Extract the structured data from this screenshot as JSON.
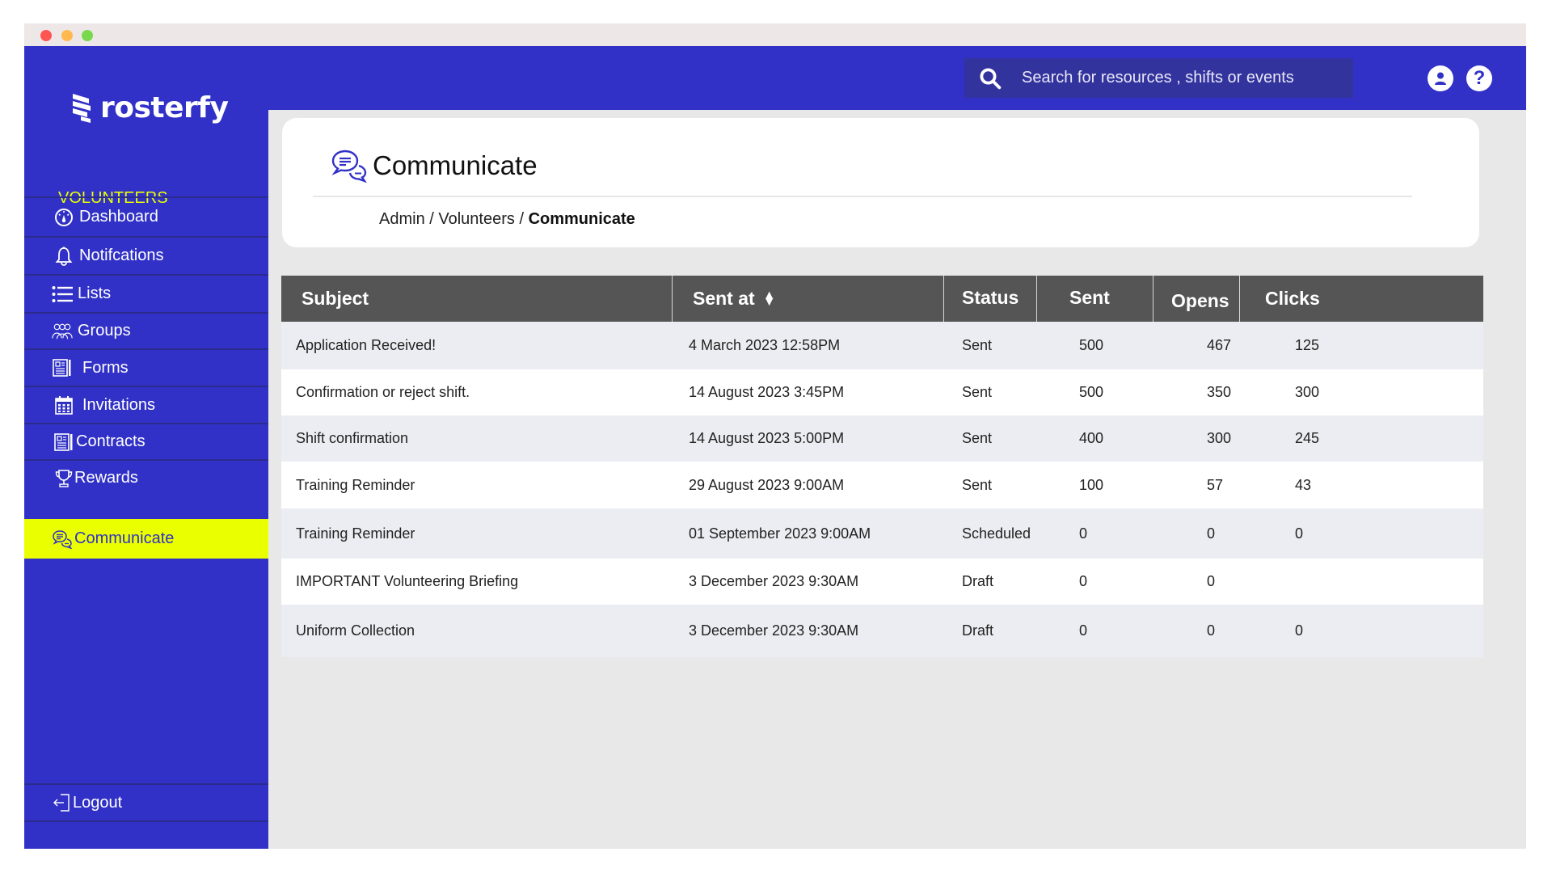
{
  "window": {
    "controls": [
      "close",
      "minimize",
      "maximize"
    ]
  },
  "brand": {
    "name": "rosterfy",
    "primary_color": "#3131c7",
    "accent_color": "#eaff00"
  },
  "topbar": {
    "search_placeholder": "Search for resources , shifts or events",
    "search_icon": "search-icon",
    "user_icon": "user-icon",
    "help_icon": "help-icon",
    "help_glyph": "?"
  },
  "sidebar": {
    "section_label": "VOLUNTEERS",
    "items": [
      {
        "label": "Dashboard",
        "icon": "dashboard-icon",
        "active": false
      },
      {
        "label": "Notifcations",
        "icon": "bell-icon",
        "active": false
      },
      {
        "label": "Lists",
        "icon": "list-icon",
        "active": false
      },
      {
        "label": "Groups",
        "icon": "groups-icon",
        "active": false
      },
      {
        "label": "Forms",
        "icon": "forms-icon",
        "active": false
      },
      {
        "label": "Invitations",
        "icon": "calendar-icon",
        "active": false
      },
      {
        "label": "Contracts",
        "icon": "contracts-icon",
        "active": false
      },
      {
        "label": "Rewards",
        "icon": "trophy-icon",
        "active": false
      },
      {
        "label": "Communicate",
        "icon": "chat-icon",
        "active": true
      }
    ],
    "logout_label": "Logout"
  },
  "page": {
    "title": "Communicate",
    "title_icon": "chat-icon",
    "breadcrumb": {
      "items": [
        "Admin",
        "Volunteers"
      ],
      "separator": " / ",
      "current": "Communicate"
    }
  },
  "table": {
    "columns": [
      "Subject",
      "Sent at",
      "Status",
      "Sent",
      "Opens",
      "Clicks"
    ],
    "sortable_column": "Sent at",
    "rows": [
      {
        "subject": "Application Received!",
        "sent_at": "4 March 2023 12:58PM",
        "status": "Sent",
        "sent": "500",
        "opens": "467",
        "clicks": "125"
      },
      {
        "subject": "Confirmation or reject shift.",
        "sent_at": "14 August 2023 3:45PM",
        "status": "Sent",
        "sent": "500",
        "opens": "350",
        "clicks": "300"
      },
      {
        "subject": "Shift confirmation",
        "sent_at": "14 August 2023 5:00PM",
        "status": "Sent",
        "sent": "400",
        "opens": "300",
        "clicks": "245"
      },
      {
        "subject": "Training Reminder",
        "sent_at": "29 August 2023 9:00AM",
        "status": "Sent",
        "sent": "100",
        "opens": "57",
        "clicks": "43"
      },
      {
        "subject": "Training Reminder",
        "sent_at": "01 September 2023 9:00AM",
        "status": "Scheduled",
        "sent": "0",
        "opens": "0",
        "clicks": "0"
      },
      {
        "subject": "IMPORTANT Volunteering Briefing",
        "sent_at": "3 December 2023 9:30AM",
        "status": "Draft",
        "sent": "0",
        "opens": "0",
        "clicks": ""
      },
      {
        "subject": "Uniform Collection",
        "sent_at": "3 December 2023 9:30AM",
        "status": "Draft",
        "sent": "0",
        "opens": "0",
        "clicks": "0"
      }
    ]
  }
}
